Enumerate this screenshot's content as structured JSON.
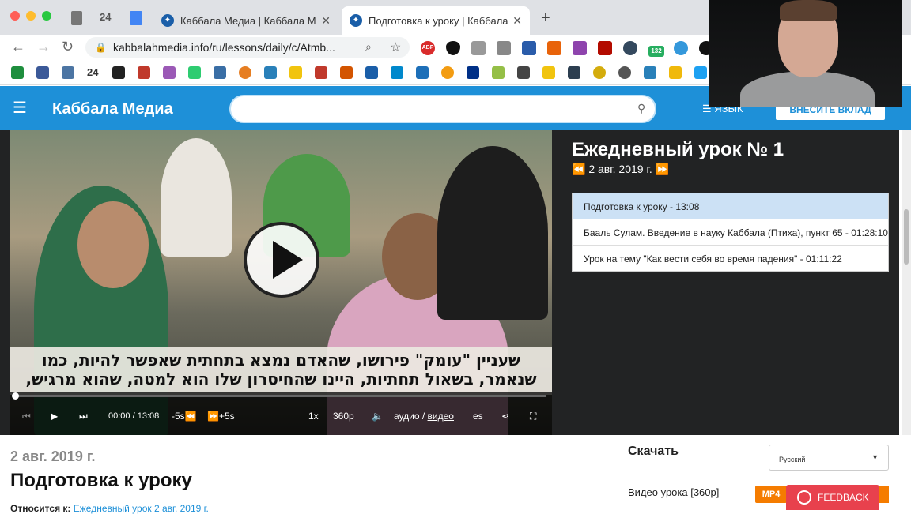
{
  "browser": {
    "tabs": [
      {
        "label": "Каббала Медиа | Каббала Ме"
      },
      {
        "label": "Подготовка к уроку | Каббала"
      }
    ],
    "pinned_24": "24",
    "new_tab": "+",
    "url": "kabbalahmedia.info/ru/lessons/daily/c/Atmb...",
    "bookmark_24": "24",
    "ext_badge": "132",
    "ext_abp": "ABP"
  },
  "site": {
    "logo": "Каббала Медиа",
    "lang_label": "ЯЗЫК",
    "donate_label": "ВНЕСИТЕ ВКЛАД",
    "accent": "#1e90d8"
  },
  "player": {
    "subtitle_lines": [
      "שעניין \"עומק\" פירושו, שהאדם נמצא בתחתית שאפשר להיות, כמו",
      "שנאמר, בשאול תחתיות, היינו שהחיסרון שלו הוא למטה, שהוא מרגיש,"
    ],
    "time": "00:00 / 13:08",
    "back_label": "-5s",
    "fwd_label": "+5s",
    "speed": "1x",
    "quality": "360p",
    "audio_label": "аудио",
    "video_label": "видео",
    "sub_lang": "es",
    "progress": 0
  },
  "lesson": {
    "title": "Ежедневный урок № 1",
    "date": "2 авг. 2019 г.",
    "items": [
      {
        "label": "Подготовка к уроку - 13:08"
      },
      {
        "label": "Бааль Сулам. Введение в науку Каббала (Птиха), пункт 65 - 01:28:10"
      },
      {
        "label": "Урок на тему \"Как вести себя во время падения\" - 01:11:22"
      }
    ]
  },
  "details": {
    "date": "2 авг. 2019 г.",
    "title": "Подготовка к уроку",
    "relates_label": "Относится к:",
    "relates_link": "Ежедневный урок 2 авг. 2019 г."
  },
  "download": {
    "heading": "Скачать",
    "language": "Русский",
    "video_label": "Видео урока [360p]",
    "format": "MP4"
  },
  "feedback": "FEEDBACK"
}
